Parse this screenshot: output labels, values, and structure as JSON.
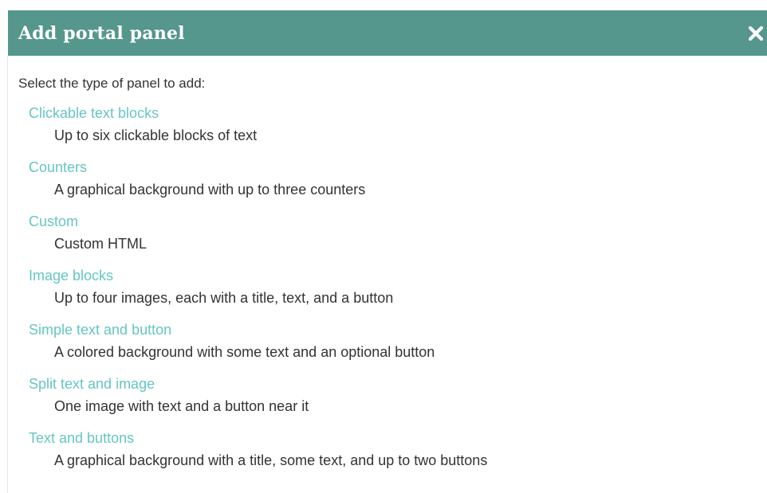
{
  "dialog": {
    "title": "Add portal panel",
    "close_icon": "close-icon",
    "header_color": "#55968d",
    "intro": "Select the type of panel to add:"
  },
  "panel_types": [
    {
      "name": "Clickable text blocks",
      "description": "Up to six clickable blocks of text"
    },
    {
      "name": "Counters",
      "description": "A graphical background with up to three counters"
    },
    {
      "name": "Custom",
      "description": "Custom HTML"
    },
    {
      "name": "Image blocks",
      "description": "Up to four images, each with a title, text, and a button"
    },
    {
      "name": "Simple text and button",
      "description": "A colored background with some text and an optional button"
    },
    {
      "name": "Split text and image",
      "description": "One image with text and a button near it"
    },
    {
      "name": "Text and buttons",
      "description": "A graphical background with a title, some text, and up to two buttons"
    }
  ],
  "colors": {
    "link": "#66c6c3",
    "text": "#333333"
  }
}
